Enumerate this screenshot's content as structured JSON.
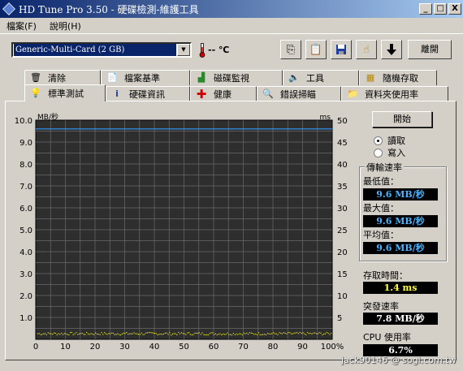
{
  "window": {
    "title": "HD Tune Pro 3.50 - 硬碟檢測-維護工具",
    "min": "_",
    "max": "□",
    "close": "X"
  },
  "menu": {
    "items": [
      "檔案(F)",
      "說明(H)"
    ]
  },
  "toolbar": {
    "drive": "Generic-Multi-Card (2 GB)",
    "temperature": "-- ℃",
    "exit_label": "離開"
  },
  "tabs_top": [
    "清除",
    "檔案基準",
    "磁碟監視",
    "工具",
    "隨機存取"
  ],
  "tabs_bottom": [
    "標準測試",
    "硬碟資訊",
    "健康",
    "錯誤掃瞄",
    "資料夾使用率"
  ],
  "active_tab": "標準測試",
  "benchmark": {
    "start_label": "開始",
    "mode_read": "讀取",
    "mode_write": "寫入",
    "selected_mode": "讀取",
    "transfer_title": "傳輸速率",
    "min_label": "最低值：",
    "min_value": "9.6 MB/秒",
    "max_label": "最大值：",
    "max_value": "9.6 MB/秒",
    "avg_label": "平均值：",
    "avg_value": "9.6 MB/秒",
    "access_label": "存取時間：",
    "access_value": "1.4 ms",
    "burst_label": "突發速率",
    "burst_value": "7.8 MB/秒",
    "cpu_label": "CPU 使用率",
    "cpu_value": "6.7%"
  },
  "watermark": "jack90146 @ sogi.com.tw",
  "colors": {
    "title_start": "#0a246a",
    "title_end": "#a6caf0",
    "chart_bg": "#2e2e2e",
    "grid": "#6a6a6a",
    "read_line": "#3399ff",
    "access_points": "#e0e020",
    "value_blue": "#4bb3ff",
    "value_yellow": "#ffff40"
  },
  "chart_data": {
    "type": "line",
    "left_unit": "MB/秒",
    "right_unit": "ms",
    "y_left_ticks": [
      "10.0",
      "9.0",
      "8.0",
      "7.0",
      "6.0",
      "5.0",
      "4.0",
      "3.0",
      "2.0",
      "1.0"
    ],
    "y_right_ticks": [
      "50",
      "45",
      "40",
      "35",
      "30",
      "25",
      "20",
      "15",
      "10",
      "5"
    ],
    "x_ticks": [
      "0",
      "10",
      "20",
      "30",
      "40",
      "50",
      "60",
      "70",
      "80",
      "90",
      "100%"
    ],
    "ylim_left": [
      0,
      10
    ],
    "ylim_right": [
      0,
      50
    ],
    "xlim": [
      0,
      100
    ],
    "series": [
      {
        "name": "",
        "axis": "left",
        "values_const": 9.6
      },
      {
        "name": "",
        "axis": "right",
        "values_const": 1.4
      }
    ]
  }
}
